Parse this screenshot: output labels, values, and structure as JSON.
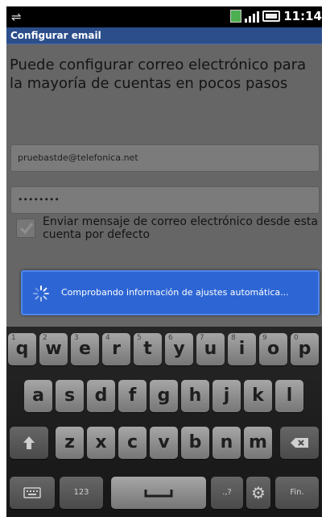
{
  "statusbar": {
    "time": "11:14",
    "usb_icon": "usb-icon",
    "sim_icon": "sim-icon",
    "signal_icon": "signal-icon",
    "battery_icon": "battery-icon"
  },
  "titlebar": {
    "title": "Configurar email"
  },
  "main": {
    "heading": "Puede configurar correo electrónico para la mayoría de cuentas en pocos pasos",
    "email_value": "pruebastde@telefonica.net",
    "password_value": "••••••••",
    "default_account_label": "Enviar mensaje de correo electrónico desde esta cuenta por defecto",
    "default_account_checked": true
  },
  "toast": {
    "text": "Comprobando información de ajustes automática..."
  },
  "keyboard": {
    "row1": [
      {
        "key": "q",
        "hint": "1"
      },
      {
        "key": "w",
        "hint": "2"
      },
      {
        "key": "e",
        "hint": "3"
      },
      {
        "key": "r",
        "hint": "4"
      },
      {
        "key": "t",
        "hint": "5"
      },
      {
        "key": "y",
        "hint": "6"
      },
      {
        "key": "u",
        "hint": "7"
      },
      {
        "key": "i",
        "hint": "8"
      },
      {
        "key": "o",
        "hint": "9"
      },
      {
        "key": "p",
        "hint": "0"
      }
    ],
    "row2": [
      "a",
      "s",
      "d",
      "f",
      "g",
      "h",
      "j",
      "k",
      "l"
    ],
    "row3": [
      "z",
      "x",
      "c",
      "v",
      "b",
      "n",
      "m"
    ],
    "shift_icon": "shift-arrow-icon",
    "backspace_icon": "backspace-icon",
    "mode_key_icon": "keyboard-mode-icon",
    "numbers_label": "123",
    "space_icon": "space-bar-icon",
    "symbols_label": ".,?",
    "settings_icon": "gear-icon",
    "enter_label": "Fin."
  }
}
